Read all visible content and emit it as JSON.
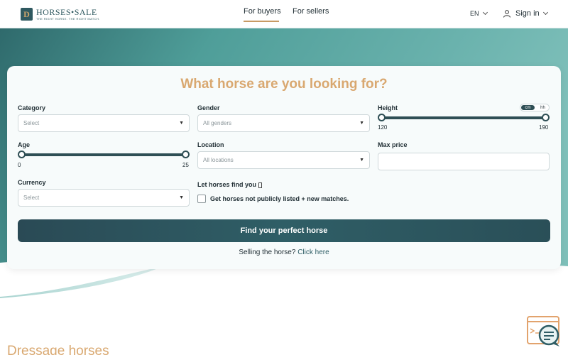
{
  "header": {
    "logo_word": "HORSES•SALE",
    "logo_tagline": "THE RIGHT HORSE. THE RIGHT MATCH.",
    "nav": [
      {
        "label": "For buyers",
        "active": true
      },
      {
        "label": "For sellers",
        "active": false
      }
    ],
    "language": "EN",
    "signin_label": "Sign in"
  },
  "search": {
    "title": "What horse are you looking for?",
    "category": {
      "label": "Category",
      "value": "Select"
    },
    "gender": {
      "label": "Gender",
      "value": "All genders"
    },
    "height": {
      "label": "Height",
      "min": "120",
      "max": "190",
      "unit_cm": "cm",
      "unit_hh": "hh",
      "selected_unit": "cm"
    },
    "age": {
      "label": "Age",
      "min": "0",
      "max": "25"
    },
    "location": {
      "label": "Location",
      "value": "All locations"
    },
    "max_price": {
      "label": "Max price",
      "value": ""
    },
    "currency": {
      "label": "Currency",
      "value": "Select"
    },
    "let_horses_find_you": {
      "label": "Let horses find you",
      "checkbox_label": "Get horses not publicly listed + new matches.",
      "checked": false
    },
    "find_button": "Find your perfect horse",
    "selling_text": "Selling the horse?",
    "selling_link": "Click here"
  },
  "section_title": "Dressage horses",
  "colors": {
    "accent": "#d9a870",
    "brand_dark": "#2f4f55",
    "hero_teal": "#4e9f9b"
  }
}
